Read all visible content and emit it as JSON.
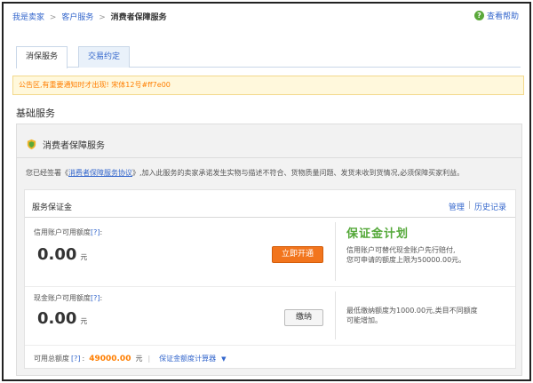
{
  "breadcrumb": {
    "items": [
      "我是卖家",
      "客户服务"
    ],
    "separator": ">",
    "current": "消费者保障服务"
  },
  "help": {
    "icon": "question-icon",
    "label": "查看帮助"
  },
  "tabs": [
    {
      "label": "消保服务",
      "active": true
    },
    {
      "label": "交易约定",
      "active": false
    }
  ],
  "notice": {
    "text": "公告区,有重要通知时才出现!  宋体12号#ff7e00",
    "color": "#ff7e00"
  },
  "section_title": "基础服务",
  "panel": {
    "icon": "shield-icon",
    "title": "消费者保障服务",
    "desc_before": "您已经签署《",
    "desc_link": "消费者保障服务协议",
    "desc_after": "》,加入此服务的卖家承诺发生实物与描述不符合、货物质量问题、发货未收到货情况,必须保障买家利益。"
  },
  "deposit": {
    "title": "服务保证金",
    "links": [
      "管理",
      "历史记录"
    ],
    "link_separator": "|",
    "credit": {
      "label": "信用账户可用额度",
      "hint": "[?]",
      "colon": ":",
      "amount": "0.00",
      "unit": "元",
      "button": "立即开通",
      "brand": "保证金计划",
      "info_line1": "信用账户可替代现金账户先行赔付,",
      "info_line2": "您可申请的额度上限为50000.00元。"
    },
    "cash": {
      "label": "现金账户可用额度",
      "hint": "[?]",
      "colon": ":",
      "amount": "0.00",
      "unit": "元",
      "button": "缴纳",
      "info_line1": "最低缴纳额度为1000.00元,类目不同额度",
      "info_line2": "可能增加。"
    },
    "total": {
      "label": "可用总额度",
      "hint": "[?]",
      "colon": ":",
      "value": "49000.00",
      "unit": "元",
      "divider": "|",
      "calculator": "保证金额度计算器",
      "arrow": "▼"
    }
  },
  "colors": {
    "accent": "#3366cc",
    "notice": "#ff7e00",
    "button": "#f2751d",
    "brand": "#54a839"
  }
}
